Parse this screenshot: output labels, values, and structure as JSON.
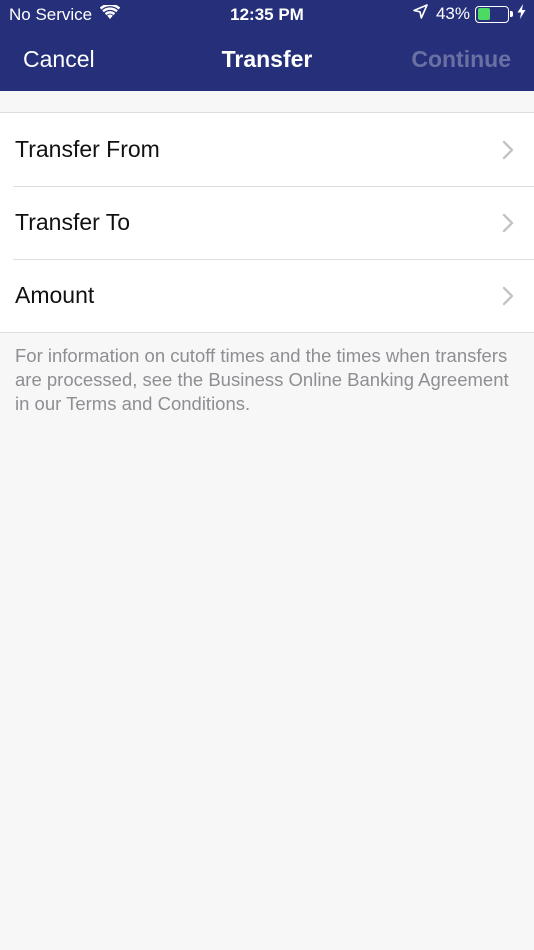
{
  "status_bar": {
    "carrier": "No Service",
    "time": "12:35 PM",
    "battery_percent": "43%",
    "battery_level": 0.43,
    "icons": [
      "wifi-icon",
      "location-arrow-icon",
      "battery-icon",
      "charging-bolt-icon"
    ]
  },
  "navbar": {
    "cancel_label": "Cancel",
    "title": "Transfer",
    "continue_label": "Continue",
    "background_color": "#26307a",
    "continue_disabled_color": "#6a70a3"
  },
  "transfer_rows": [
    {
      "label": "Transfer From",
      "icon": "chevron-right-icon"
    },
    {
      "label": "Transfer To",
      "icon": "chevron-right-icon"
    },
    {
      "label": "Amount",
      "icon": "chevron-right-icon"
    }
  ],
  "footer_note": "For information on cutoff times and the times when transfers are processed, see the Business Online Banking Agreement in our Terms and Conditions."
}
